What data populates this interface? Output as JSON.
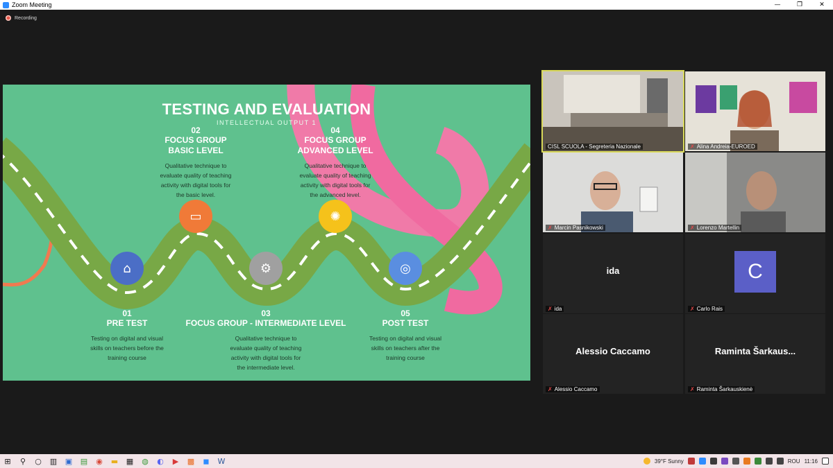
{
  "window": {
    "title": "Zoom Meeting",
    "controls": [
      "—",
      "❐",
      "✕"
    ]
  },
  "recording": {
    "label": "Recording"
  },
  "slide": {
    "title": "TESTING AND EVALUATION",
    "subtitle": "INTELLECTUAL OUTPUT 1",
    "steps": [
      {
        "num": "01",
        "head": "PRE TEST",
        "desc": "Testing on digital and visual\nskills on teachers before the\ntraining course",
        "icon": "house-icon",
        "color": "#4b6ec6"
      },
      {
        "num": "02",
        "head": "FOCUS GROUP\nBASIC LEVEL",
        "desc": "Qualitative technique to\nevaluate quality of teaching\nactivity with digital tools for\nthe basic level.",
        "icon": "briefcase-icon",
        "color": "#f07a38"
      },
      {
        "num": "03",
        "head": "FOCUS GROUP - INTERMEDIATE LEVEL",
        "desc": "Qualitative technique to\nevaluate quality of teaching\nactivity with digital tools for\nthe intermediate level.",
        "icon": "gear-icon",
        "color": "#a0a0a0"
      },
      {
        "num": "04",
        "head": "FOCUS GROUP\nADVANCED LEVEL",
        "desc": "Qualitative technique to\nevaluate quality of teaching\nactivity with digital tools for\nthe advanced  level.",
        "icon": "lightbulb-icon",
        "color": "#f5c21b"
      },
      {
        "num": "05",
        "head": "POST TEST",
        "desc": "Testing on digital and visual\nskills on teachers after the\ntraining course",
        "icon": "target-icon",
        "color": "#5a8ee0"
      }
    ]
  },
  "participants": [
    {
      "name": "CISL SCUOLA - Segreteria Nazionale",
      "video": true,
      "active": true
    },
    {
      "name": "Alina Andreia-EUROED",
      "video": true
    },
    {
      "name": "Marcin Pasnikowski",
      "video": true
    },
    {
      "name": "Lorenzo Martellin",
      "video": true
    },
    {
      "name": "ida",
      "display": "ida",
      "video": false
    },
    {
      "name": "Carlo Rais",
      "avatar_letter": "C",
      "video": false
    },
    {
      "name": "Alessio Caccamo",
      "display": "Alessio Caccamo",
      "video": false
    },
    {
      "name": "Raminta Šarkauskienė",
      "display": "Raminta  Šarkaus...",
      "video": false
    }
  ],
  "taskbar": {
    "weather": "39°F  Sunny",
    "language": "ROU",
    "time": "11:16"
  }
}
